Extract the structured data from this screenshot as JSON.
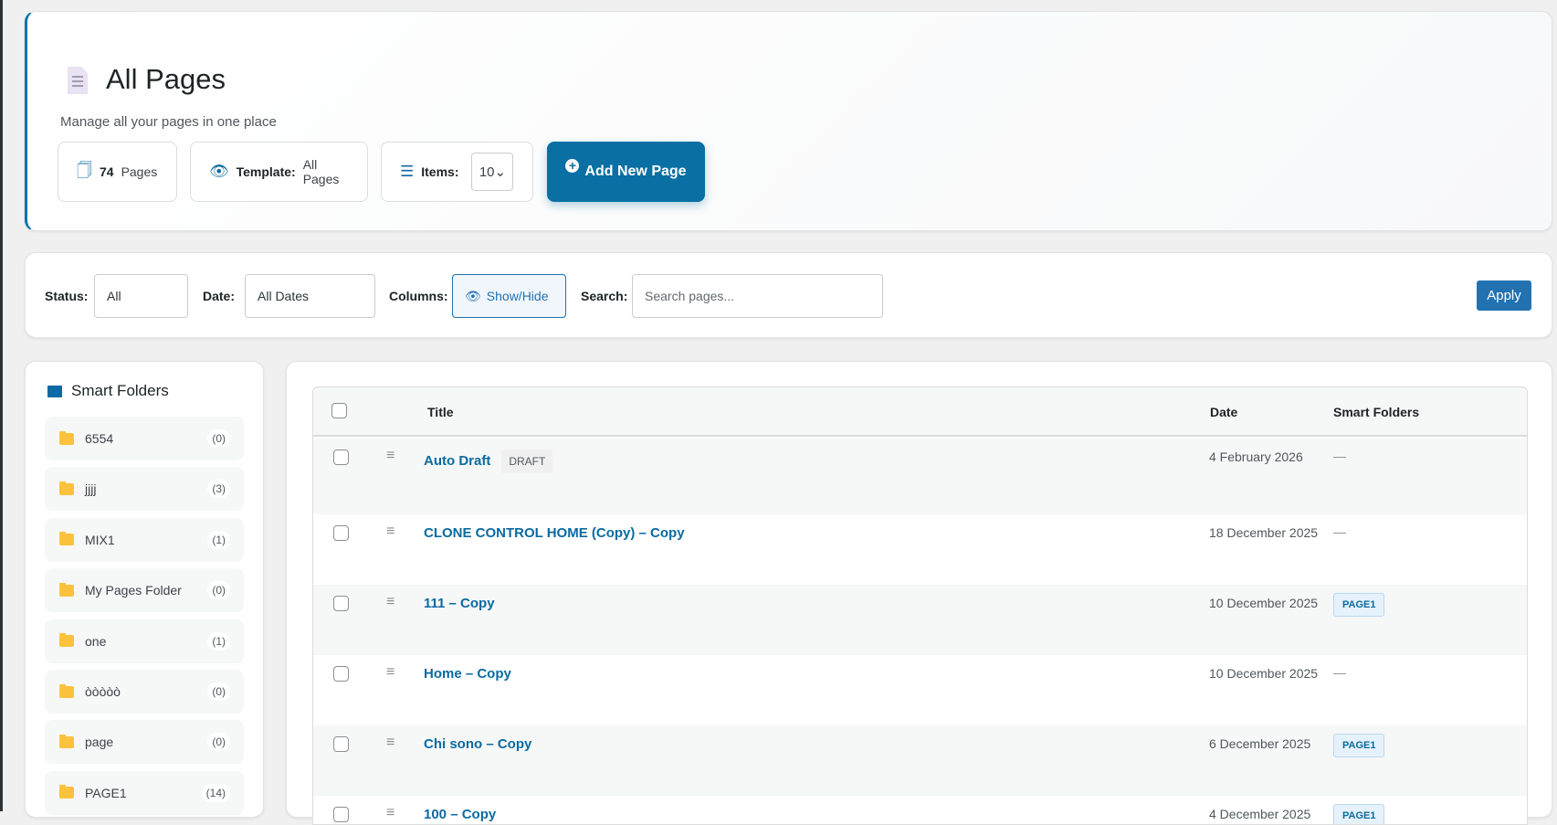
{
  "header": {
    "title": "All Pages",
    "subtitle": "Manage all your pages in one place",
    "pages_count": "74",
    "pages_label": "Pages",
    "template_label": "Template:",
    "template_value": "All Pages",
    "items_label": "Items:",
    "items_value": "10",
    "add_button": "Add New Page"
  },
  "filters": {
    "status_label": "Status:",
    "status_value": "All",
    "date_label": "Date:",
    "date_value": "All Dates",
    "columns_label": "Columns:",
    "columns_button": "Show/Hide",
    "search_label": "Search:",
    "search_placeholder": "Search pages...",
    "apply": "Apply"
  },
  "sidebar": {
    "title": "Smart Folders",
    "folders": [
      {
        "name": "6554",
        "count": "(0)"
      },
      {
        "name": "jjjj",
        "count": "(3)"
      },
      {
        "name": "MIX1",
        "count": "(1)"
      },
      {
        "name": "My Pages Folder",
        "count": "(0)"
      },
      {
        "name": "one",
        "count": "(1)"
      },
      {
        "name": "òòòòò",
        "count": "(0)"
      },
      {
        "name": "page",
        "count": "(0)"
      },
      {
        "name": "PAGE1",
        "count": "(14)"
      }
    ]
  },
  "table": {
    "headers": {
      "title": "Title",
      "date": "Date",
      "folders": "Smart Folders"
    },
    "rows": [
      {
        "title": "Auto Draft",
        "badge": "DRAFT",
        "date": "4 February 2026",
        "folder": "—"
      },
      {
        "title": "CLONE CONTROL HOME (Copy) – Copy",
        "date": "18 December 2025",
        "folder": "—"
      },
      {
        "title": "111 – Copy",
        "date": "10 December 2025",
        "folder": "PAGE1"
      },
      {
        "title": "Home – Copy",
        "date": "10 December 2025",
        "folder": "—"
      },
      {
        "title": "Chi sono – Copy",
        "date": "6 December 2025",
        "folder": "PAGE1"
      },
      {
        "title": "100 – Copy",
        "date": "4 December 2025",
        "folder": "PAGE1"
      }
    ]
  }
}
